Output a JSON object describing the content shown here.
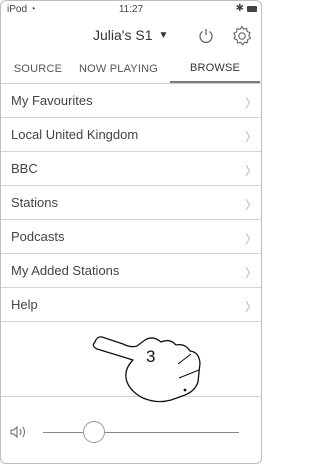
{
  "status": {
    "carrier": "iPod",
    "wifi_icon": "wifi-icon",
    "time": "11:27",
    "bluetooth_icon": "bluetooth-icon",
    "battery_icon": "battery-icon"
  },
  "header": {
    "device_name": "Julia's S1",
    "caret": "▼",
    "power_icon": "power-icon",
    "settings_icon": "gear-icon"
  },
  "tabs": [
    {
      "label": "SOURCE",
      "selected": false
    },
    {
      "label": "NOW PLAYING",
      "selected": false
    },
    {
      "label": "BROWSE",
      "selected": true
    }
  ],
  "list": {
    "items": [
      {
        "label": "My Favourites"
      },
      {
        "label": "Local United Kingdom"
      },
      {
        "label": "BBC"
      },
      {
        "label": "Stations"
      },
      {
        "label": "Podcasts"
      },
      {
        "label": "My Added Stations"
      },
      {
        "label": "Help"
      }
    ],
    "chevron": "〉"
  },
  "callout": {
    "number": "3"
  },
  "volume": {
    "icon": "speaker-icon",
    "level": 0.26
  }
}
